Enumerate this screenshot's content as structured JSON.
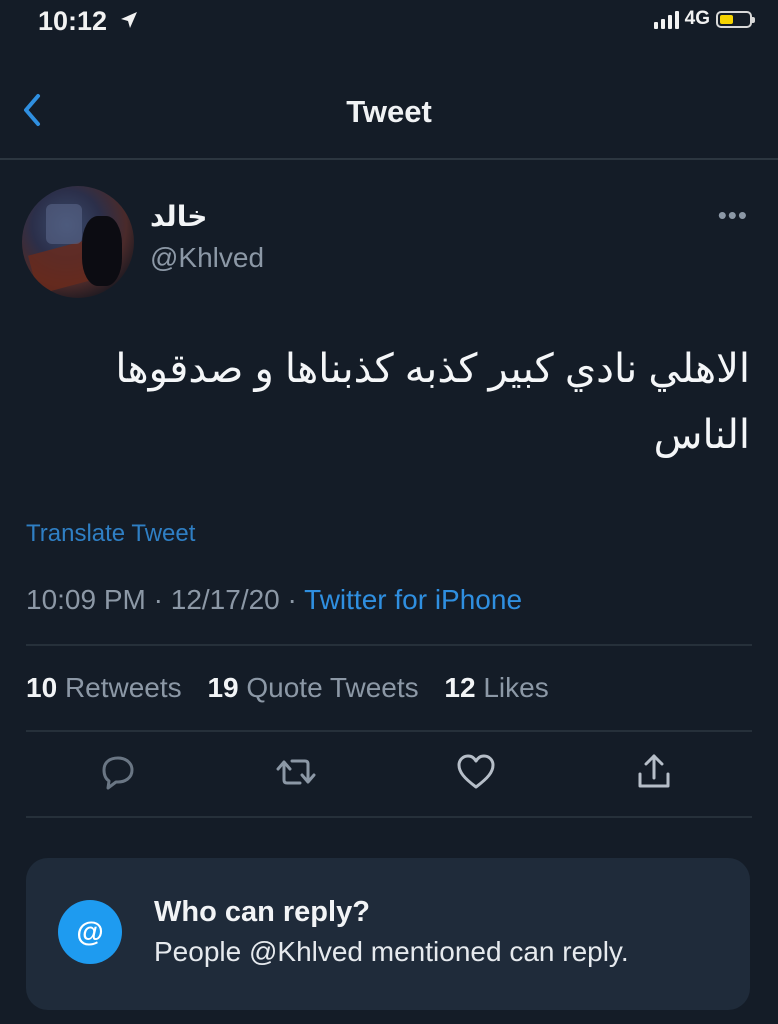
{
  "status": {
    "time": "10:12",
    "network": "4G"
  },
  "nav": {
    "title": "Tweet"
  },
  "tweet": {
    "display_name": "خالد",
    "handle": "@Khlved",
    "text": "الاهلي نادي كبير كذبه كذبناها و صدقوها الناس",
    "translate_label": "Translate Tweet",
    "time": "10:09 PM",
    "date": "12/17/20",
    "source": "Twitter for iPhone",
    "separator": " · "
  },
  "stats": {
    "retweets_count": "10",
    "retweets_label": "Retweets",
    "quotes_count": "19",
    "quotes_label": "Quote Tweets",
    "likes_count": "12",
    "likes_label": "Likes"
  },
  "reply_card": {
    "title": "Who can reply?",
    "subtitle": "People @Khlved mentioned can reply.",
    "badge": "@"
  },
  "colors": {
    "background": "#141c27",
    "accent": "#1e9bf0",
    "muted": "#8c98a6"
  },
  "icons": {
    "back": "chevron-left-icon",
    "more": "more-horizontal-icon",
    "reply": "reply-icon",
    "retweet": "retweet-icon",
    "like": "heart-icon",
    "share": "share-icon"
  }
}
